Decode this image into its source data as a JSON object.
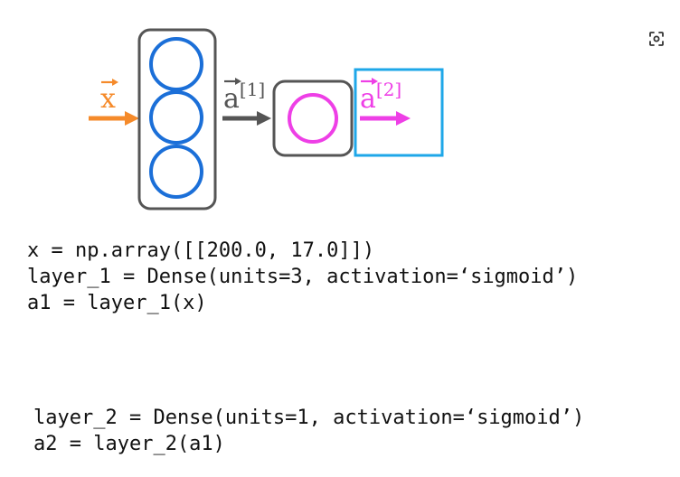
{
  "diagram": {
    "input_label": "x",
    "hidden_output_label": {
      "base": "a",
      "superscript": "[1]"
    },
    "final_output_label": {
      "base": "a",
      "superscript": "[2]"
    },
    "colors": {
      "input": "#f58a2a",
      "neuron_layer1": "#1b6fd8",
      "neuron_layer2": "#ee3fe6",
      "layer_box": "#555555",
      "hidden_arrow": "#555555",
      "output_highlight": "#1ea7e8"
    }
  },
  "lens_button": {
    "icon": "lens-scan-icon"
  },
  "code": {
    "block1": [
      "x = np.array([[200.0, 17.0]])",
      "layer_1 = Dense(units=3, activation=‘sigmoid’)",
      "a1 = layer_1(x)"
    ],
    "block2": [
      "layer_2 = Dense(units=1, activation=‘sigmoid’)",
      "a2 = layer_2(a1)"
    ]
  }
}
